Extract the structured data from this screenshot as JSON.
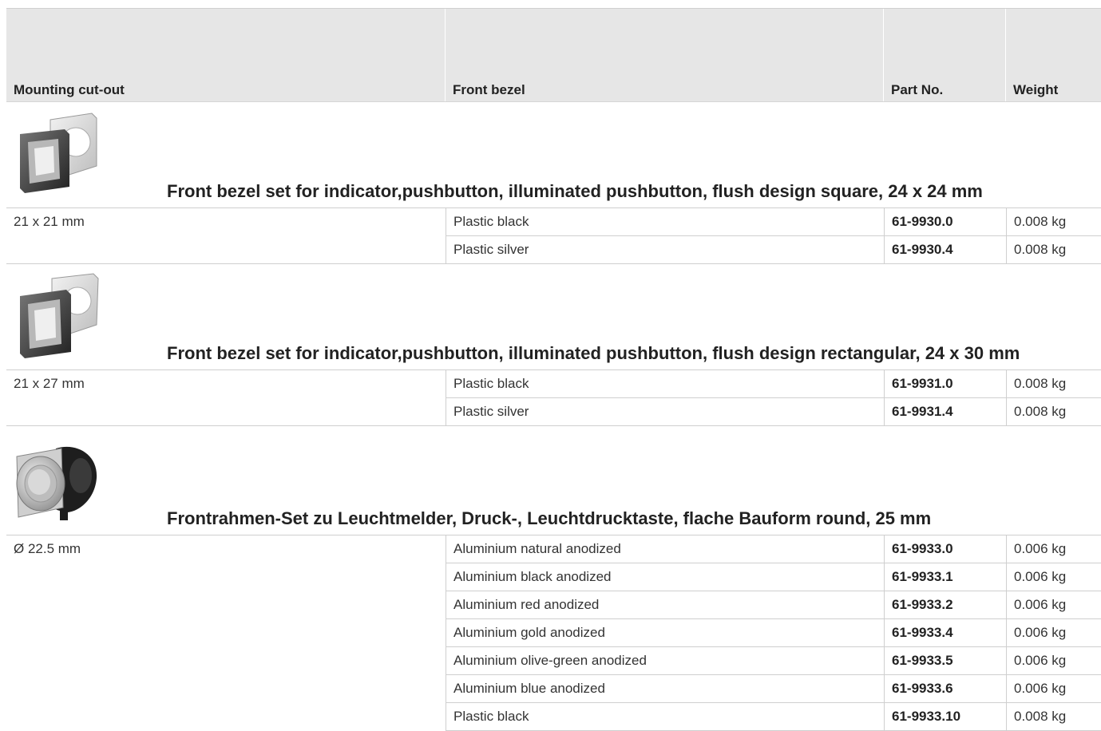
{
  "header": {
    "mounting": "Mounting cut-out",
    "bezel": "Front bezel",
    "part": "Part No.",
    "weight": "Weight"
  },
  "groups": [
    {
      "title": "Front bezel set for indicator,pushbutton, illuminated pushbutton, flush design square, 24 x 24 mm",
      "image_icon": "square-bezel-set",
      "cutout": "21 x 21 mm",
      "rows": [
        {
          "bezel": "Plastic black",
          "part": "61-9930.0",
          "weight": "0.008 kg"
        },
        {
          "bezel": "Plastic silver",
          "part": "61-9930.4",
          "weight": "0.008 kg"
        }
      ]
    },
    {
      "title": "Front bezel set for indicator,pushbutton, illuminated pushbutton, flush design rectangular, 24 x 30 mm",
      "image_icon": "rectangular-bezel-set",
      "cutout": "21 x 27 mm",
      "rows": [
        {
          "bezel": "Plastic black",
          "part": "61-9931.0",
          "weight": "0.008 kg"
        },
        {
          "bezel": "Plastic silver",
          "part": "61-9931.4",
          "weight": "0.008 kg"
        }
      ]
    },
    {
      "title": "Frontrahmen-Set zu Leuchtmelder, Druck-, Leuchtdrucktaste, flache Bauform round, 25 mm",
      "image_icon": "round-bezel-set",
      "cutout": "Ø 22.5 mm",
      "rows": [
        {
          "bezel": "Aluminium natural anodized",
          "part": "61-9933.0",
          "weight": "0.006 kg"
        },
        {
          "bezel": "Aluminium black anodized",
          "part": "61-9933.1",
          "weight": "0.006 kg"
        },
        {
          "bezel": "Aluminium red anodized",
          "part": "61-9933.2",
          "weight": "0.006 kg"
        },
        {
          "bezel": "Aluminium gold anodized",
          "part": "61-9933.4",
          "weight": "0.006 kg"
        },
        {
          "bezel": "Aluminium olive-green anodized",
          "part": "61-9933.5",
          "weight": "0.006 kg"
        },
        {
          "bezel": "Aluminium blue anodized",
          "part": "61-9933.6",
          "weight": "0.006 kg"
        },
        {
          "bezel": "Plastic black",
          "part": "61-9933.10",
          "weight": "0.008 kg"
        }
      ]
    }
  ]
}
